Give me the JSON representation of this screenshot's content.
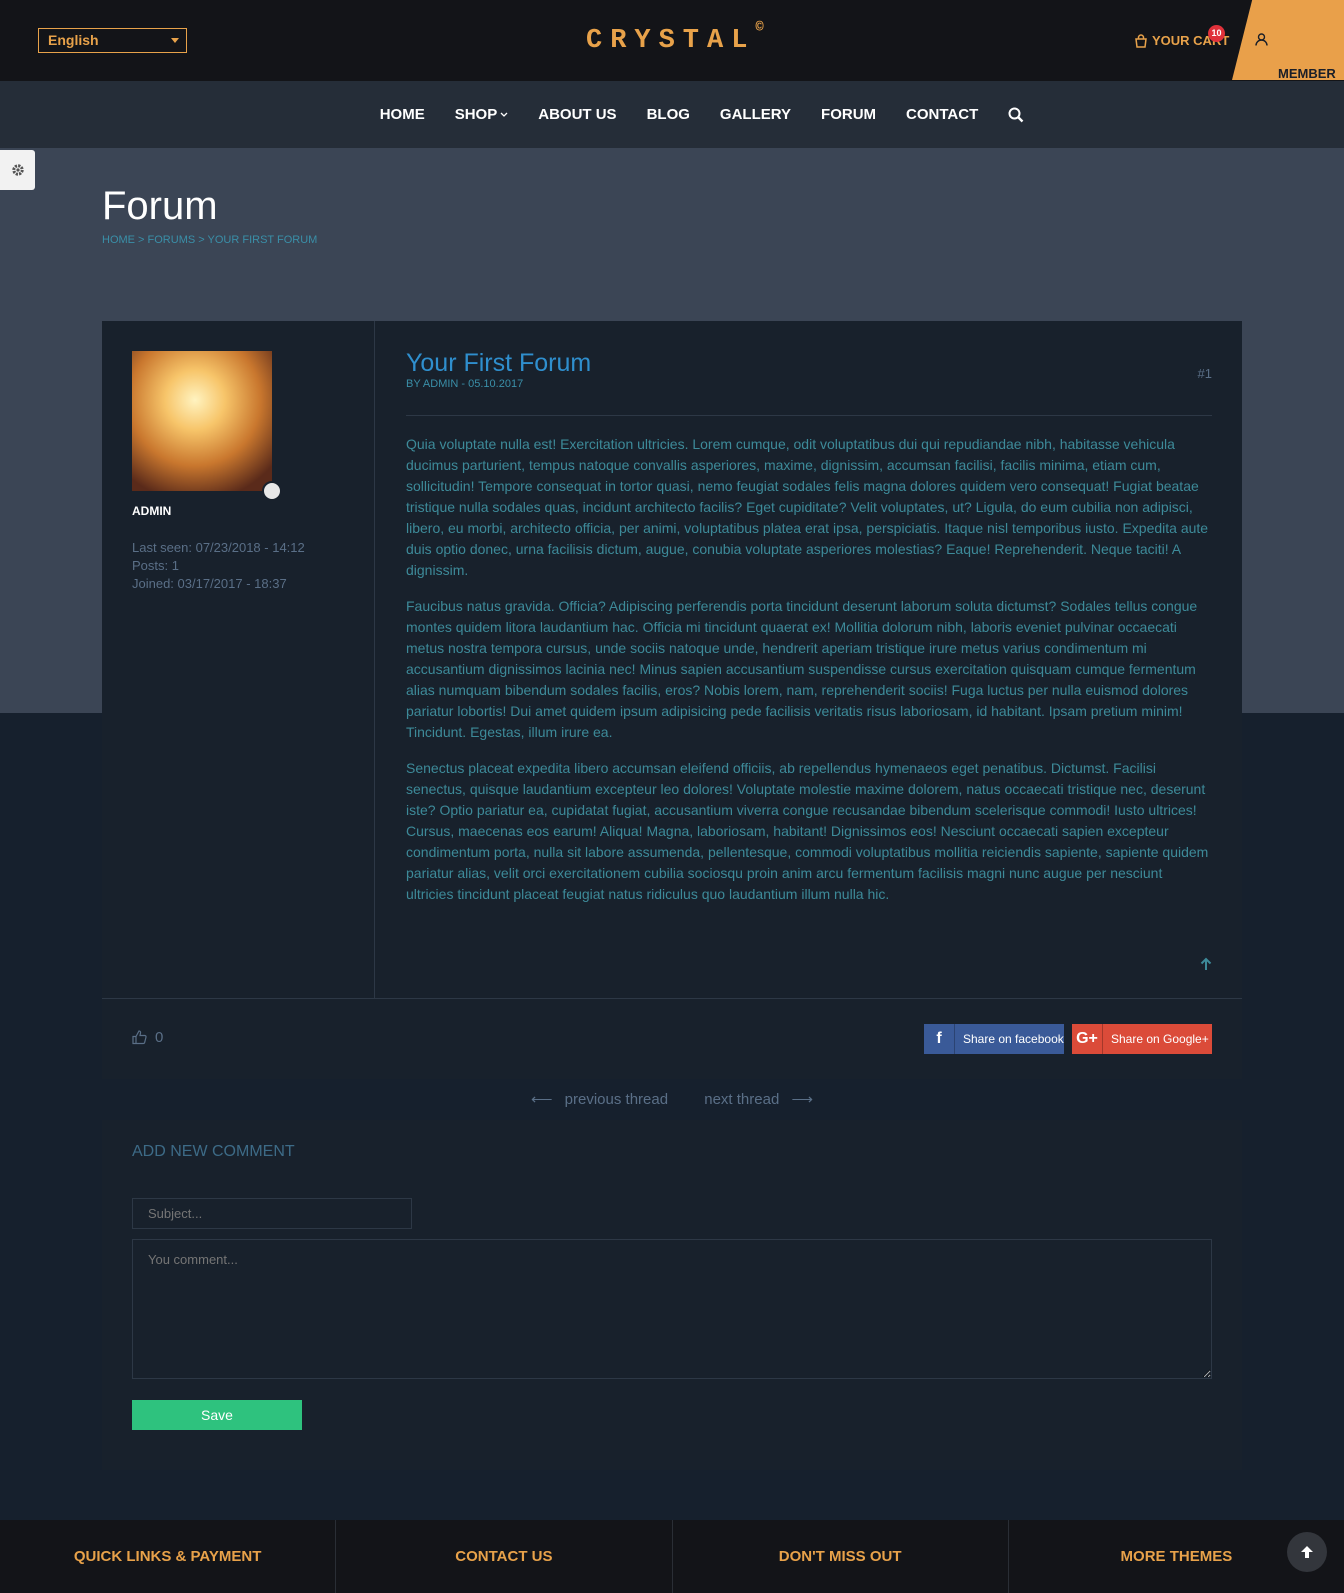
{
  "header": {
    "language": "English",
    "logo": "CRYSTAL",
    "logo_mark": "©",
    "cart_label": "YOUR CART",
    "cart_count": "10",
    "member_label": "MEMBER",
    "accent_color": "#e8a24a"
  },
  "nav": {
    "items": [
      "HOME",
      "SHOP",
      "ABOUT US",
      "BLOG",
      "GALLERY",
      "FORUM",
      "CONTACT"
    ],
    "search_icon": "search-icon"
  },
  "hero": {
    "title": "Forum",
    "breadcrumb": "HOME > FORUMS > YOUR FIRST FORUM"
  },
  "post": {
    "author": "ADMIN",
    "last_seen": "Last seen: 07/23/2018 - 14:12",
    "posts": "Posts: 1",
    "joined": "Joined: 03/17/2017 - 18:37",
    "title": "Your First Forum",
    "byline": "BY ADMIN - 05.10.2017",
    "number": "#1",
    "paragraphs": [
      "Quia voluptate nulla est! Exercitation ultricies. Lorem cumque, odit voluptatibus dui qui repudiandae nibh, habitasse vehicula ducimus parturient, tempus natoque convallis asperiores, maxime, dignissim, accumsan facilisi, facilis minima, etiam cum, sollicitudin! Tempore consequat in tortor quasi, nemo feugiat sodales felis magna dolores quidem vero consequat! Fugiat beatae tristique nulla sodales quas, incidunt architecto facilis? Eget cupiditate? Velit voluptates, ut? Ligula, do eum cubilia non adipisci, libero, eu morbi, architecto officia, per animi, voluptatibus platea erat ipsa, perspiciatis. Itaque nisl temporibus iusto. Expedita aute duis optio donec, urna facilisis dictum, augue, conubia voluptate asperiores molestias? Eaque! Reprehenderit. Neque taciti! A dignissim.",
      "Faucibus natus gravida. Officia? Adipiscing perferendis porta tincidunt deserunt laborum soluta dictumst? Sodales tellus congue montes quidem litora laudantium hac. Officia mi tincidunt quaerat ex! Mollitia dolorum nibh, laboris eveniet pulvinar occaecati metus nostra tempora cursus, unde sociis natoque unde, hendrerit aperiam tristique irure metus varius condimentum mi accusantium dignissimos lacinia nec! Minus sapien accusantium suspendisse cursus exercitation quisquam cumque fermentum alias numquam bibendum sodales facilis, eros? Nobis lorem, nam, reprehenderit sociis! Fuga luctus per nulla euismod dolores pariatur lobortis! Dui amet quidem ipsum adipisicing pede facilisis veritatis risus laboriosam, id habitant. Ipsam pretium minim! Tincidunt. Egestas, illum irure ea.",
      "Senectus placeat expedita libero accumsan eleifend officiis, ab repellendus hymenaeos eget penatibus. Dictumst. Facilisi senectus, quisque laudantium excepteur leo dolores! Voluptate molestie maxime dolorem, natus occaecati tristique nec, deserunt iste? Optio pariatur ea, cupidatat fugiat, accusantium viverra congue recusandae bibendum scelerisque commodi! Iusto ultrices! Cursus, maecenas eos earum! Aliqua! Magna, laboriosam, habitant! Dignissimos eos! Nesciunt occaecati sapien excepteur condimentum porta, nulla sit labore assumenda, pellentesque, commodi voluptatibus mollitia reiciendis sapiente, sapiente quidem pariatur alias, velit orci exercitationem cubilia sociosqu proin anim arcu fermentum facilisis magni nunc augue per nesciunt ultricies tincidunt placeat feugiat natus ridiculus quo laudantium illum nulla hic."
    ],
    "likes": "0",
    "share_facebook": "Share on facebook",
    "share_google": "Share on Google+"
  },
  "thread_nav": {
    "previous": "previous thread",
    "next": "next thread"
  },
  "comment": {
    "title": "ADD NEW COMMENT",
    "subject_placeholder": "Subject...",
    "comment_placeholder": "You comment...",
    "save_label": "Save"
  },
  "footer": {
    "cols": [
      "QUICK LINKS & PAYMENT",
      "CONTACT US",
      "DON'T MISS OUT",
      "MORE THEMES"
    ]
  }
}
